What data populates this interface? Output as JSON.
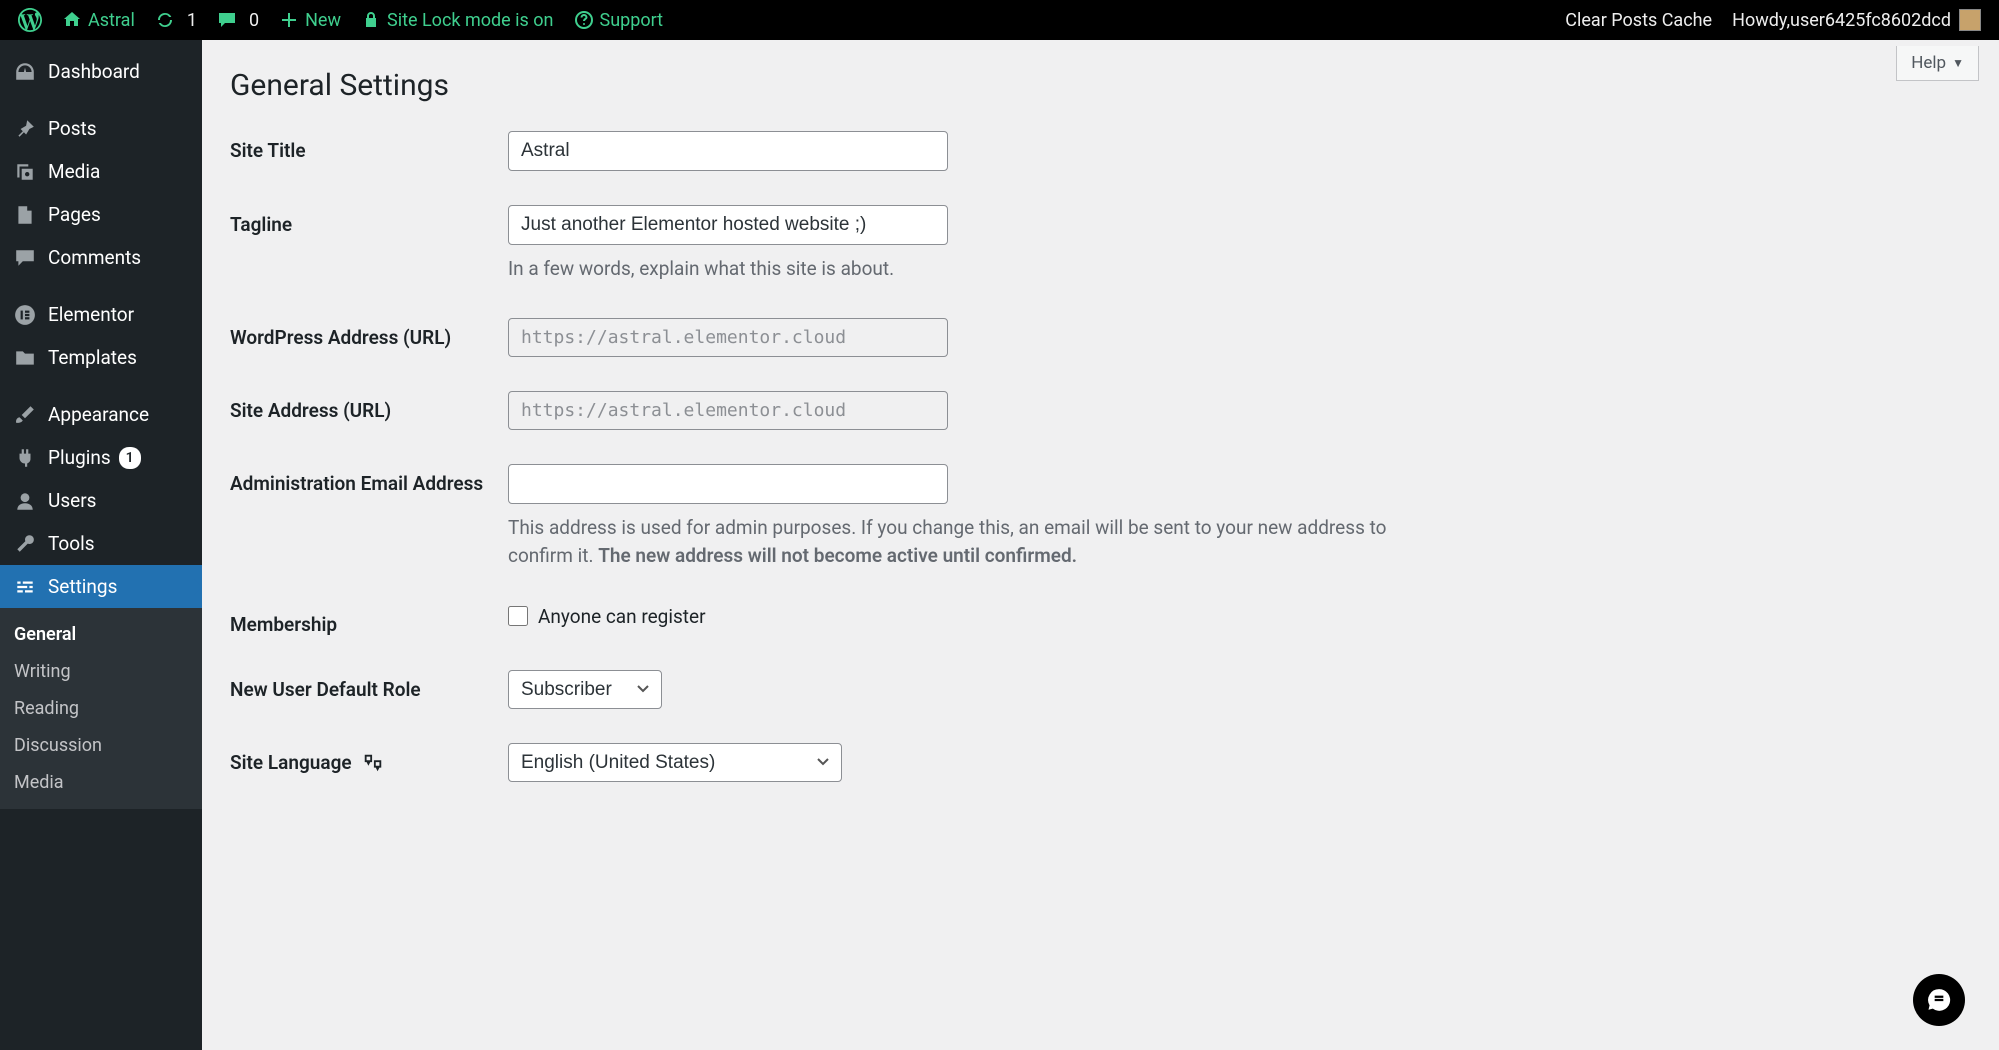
{
  "adminbar": {
    "site_name": "Astral",
    "updates_count": "1",
    "comments_count": "0",
    "new_label": "New",
    "sitelock_label": "Site Lock mode is on",
    "support_label": "Support",
    "clear_cache_label": "Clear Posts Cache",
    "howdy_prefix": "Howdy, ",
    "username": "user6425fc8602dcd"
  },
  "sidebar": {
    "dashboard": "Dashboard",
    "posts": "Posts",
    "media": "Media",
    "pages": "Pages",
    "comments": "Comments",
    "elementor": "Elementor",
    "templates": "Templates",
    "appearance": "Appearance",
    "plugins": "Plugins",
    "plugins_badge": "1",
    "users": "Users",
    "tools": "Tools",
    "settings": "Settings",
    "submenu": {
      "general": "General",
      "writing": "Writing",
      "reading": "Reading",
      "discussion": "Discussion",
      "media": "Media"
    }
  },
  "content": {
    "help_label": "Help",
    "page_title": "General Settings",
    "fields": {
      "site_title": {
        "label": "Site Title",
        "value": "Astral"
      },
      "tagline": {
        "label": "Tagline",
        "value": "Just another Elementor hosted website ;)",
        "help": "In a few words, explain what this site is about."
      },
      "wp_address": {
        "label": "WordPress Address (URL)",
        "value": "https://astral.elementor.cloud"
      },
      "site_address": {
        "label": "Site Address (URL)",
        "value": "https://astral.elementor.cloud"
      },
      "admin_email": {
        "label": "Administration Email Address",
        "value": "",
        "help_plain": "This address is used for admin purposes. If you change this, an email will be sent to your new address to confirm it. ",
        "help_bold": "The new address will not become active until confirmed."
      },
      "membership": {
        "label": "Membership",
        "checkbox_label": "Anyone can register"
      },
      "default_role": {
        "label": "New User Default Role",
        "value": "Subscriber"
      },
      "language": {
        "label": "Site Language",
        "value": "English (United States)"
      }
    }
  }
}
